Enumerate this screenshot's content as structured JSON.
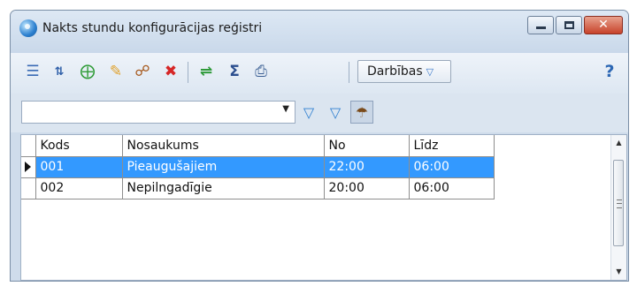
{
  "window": {
    "title": "Nakts stundu konfigurācijas reģistri",
    "close_symbol": "✕"
  },
  "toolbar": {
    "icons": [
      "insert-icon",
      "sort-icon",
      "add-icon",
      "edit-icon",
      "view-icon",
      "delete-icon",
      "refresh-icon",
      "sum-icon",
      "print-icon"
    ],
    "darbibas_label": "Darbības",
    "darbibas_arrow": "▽",
    "help_symbol": "?"
  },
  "filter": {
    "combo_value": "",
    "combo_arrow": "▼"
  },
  "table": {
    "columns": [
      "Kods",
      "Nosaukums",
      "No",
      "Līdz"
    ],
    "rows": [
      {
        "kods": "001",
        "nosaukums": "Pieaugušajiem",
        "no": "22:00",
        "lidz": "06:00"
      },
      {
        "kods": "002",
        "nosaukums": "Nepilngadīgie",
        "no": "20:00",
        "lidz": "06:00"
      }
    ],
    "selected_row": 0
  },
  "scroll": {
    "up": "▲",
    "down": "▼"
  }
}
